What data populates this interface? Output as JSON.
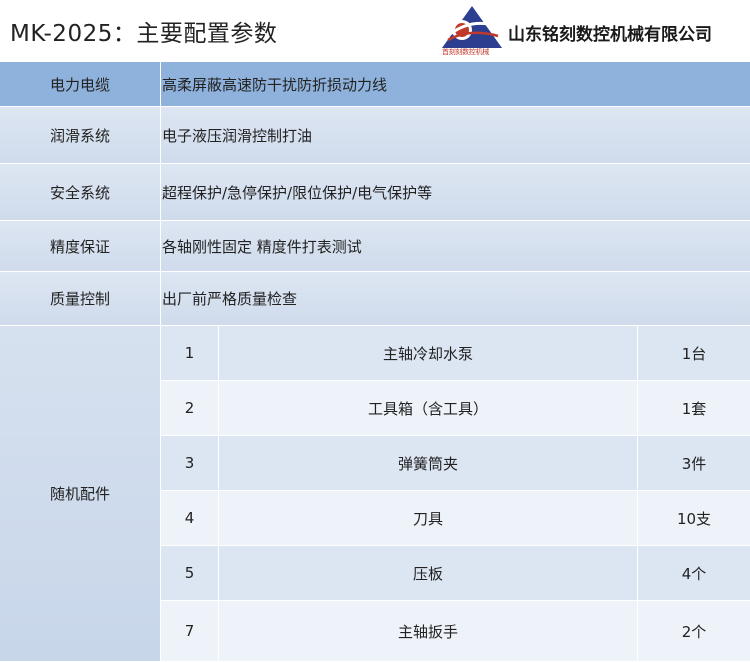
{
  "header": {
    "title": "MK-2025：主要配置参数",
    "company": "山东铭刻数控机械有限公司",
    "logo_subtitle": "首刻刻数控机械"
  },
  "specs": [
    {
      "label": "电力电缆",
      "value": "高柔屏蔽高速防干扰防折损动力线"
    },
    {
      "label": "润滑系统",
      "value": "电子液压润滑控制打油"
    },
    {
      "label": "安全系统",
      "value": "超程保护/急停保护/限位保护/电气保护等"
    },
    {
      "label": "精度保证",
      "value": "各轴刚性固定 精度件打表测试"
    },
    {
      "label": "质量控制",
      "value": "出厂前严格质量检查"
    }
  ],
  "accessories": {
    "label": "随机配件",
    "items": [
      {
        "no": "1",
        "name": "主轴冷却水泵",
        "qty": "1台"
      },
      {
        "no": "2",
        "name": "工具箱（含工具）",
        "qty": "1套"
      },
      {
        "no": "3",
        "name": "弹簧筒夹",
        "qty": "3件"
      },
      {
        "no": "4",
        "name": "刀具",
        "qty": "10支"
      },
      {
        "no": "5",
        "name": "压板",
        "qty": "4个"
      },
      {
        "no": "7",
        "name": "主轴扳手",
        "qty": "2个"
      }
    ]
  },
  "colors": {
    "header_row": "#8fb2dc",
    "row_light": "#dce6f3",
    "row_lighter": "#eef3f9",
    "logo_red": "#c0392b",
    "logo_blue": "#2c3e8f"
  }
}
